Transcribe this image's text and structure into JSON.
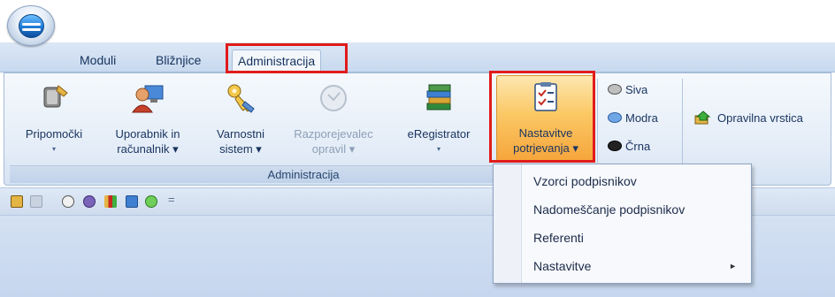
{
  "tabs": [
    {
      "label": "Moduli"
    },
    {
      "label": "Bližnjice"
    },
    {
      "label": "Administracija",
      "active": true
    }
  ],
  "ribbon": {
    "group_label": "Administracija",
    "buttons": [
      {
        "line1": "Pripomočki",
        "line2": "▾",
        "icon": "tools-icon"
      },
      {
        "line1": "Uporabnik in",
        "line2": "računalnik ▾",
        "icon": "user-computer-icon"
      },
      {
        "line1": "Varnostni",
        "line2": "sistem ▾",
        "icon": "key-icon"
      },
      {
        "line1": "Razporejevalec",
        "line2": "opravil ▾",
        "icon": "clock-icon",
        "disabled": true
      },
      {
        "line1": "eRegistrator",
        "line2": "▾",
        "icon": "books-icon"
      },
      {
        "line1": "Nastavitve",
        "line2": "potrjevanja ▾",
        "icon": "checklist-icon",
        "highlight": true
      }
    ],
    "theme_options": [
      {
        "label": "Siva",
        "color": "#bfbfbf"
      },
      {
        "label": "Modra",
        "color": "#6fa6e6"
      },
      {
        "label": "Črna",
        "color": "#222222"
      }
    ],
    "opravilna_vrstica": "Opravilna vrstica"
  },
  "qat": {
    "customize": "="
  },
  "menu": {
    "items": [
      {
        "label": "Vzorci podpisnikov"
      },
      {
        "label": "Nadomeščanje podpisnikov"
      },
      {
        "label": "Referenti"
      },
      {
        "label": "Nastavitve",
        "submenu_arrow": "►"
      }
    ]
  },
  "colors": {
    "highlight_outline": "#e11b1b",
    "ribbon_bg": "#e3ecf7"
  }
}
